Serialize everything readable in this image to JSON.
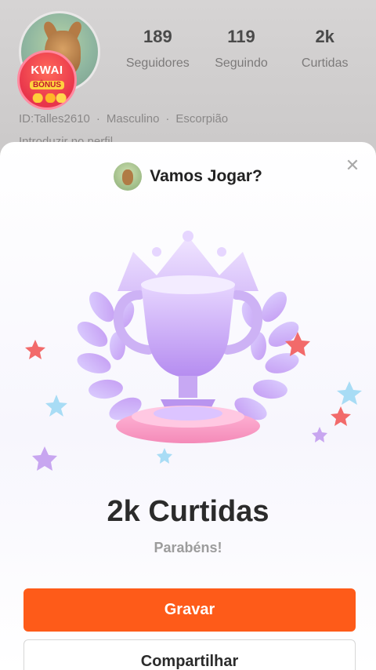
{
  "profile": {
    "badge": {
      "line1": "KWAI",
      "line2": "BÔNUS"
    },
    "stats": [
      {
        "value": "189",
        "label": "Seguidores"
      },
      {
        "value": "119",
        "label": "Seguindo"
      },
      {
        "value": "2k",
        "label": "Curtidas"
      }
    ],
    "meta": {
      "id": "ID:Talles2610",
      "gender": "Masculino",
      "sign": "Escorpião"
    },
    "bio": "Introduzir no perfil..."
  },
  "modal": {
    "header_title": "Vamos Jogar?",
    "close_icon": "close-icon",
    "trophy_icon": "trophy-icon",
    "achievement_title": "2k Curtidas",
    "subtitle": "Parabéns!",
    "primary_button": "Gravar",
    "secondary_button": "Compartilhar"
  },
  "colors": {
    "accent": "#fe5b19",
    "trophy": "#c8a6f0",
    "star_red": "#f26a6a",
    "star_blue": "#a8dcf5",
    "star_purple": "#c8a6f0"
  }
}
